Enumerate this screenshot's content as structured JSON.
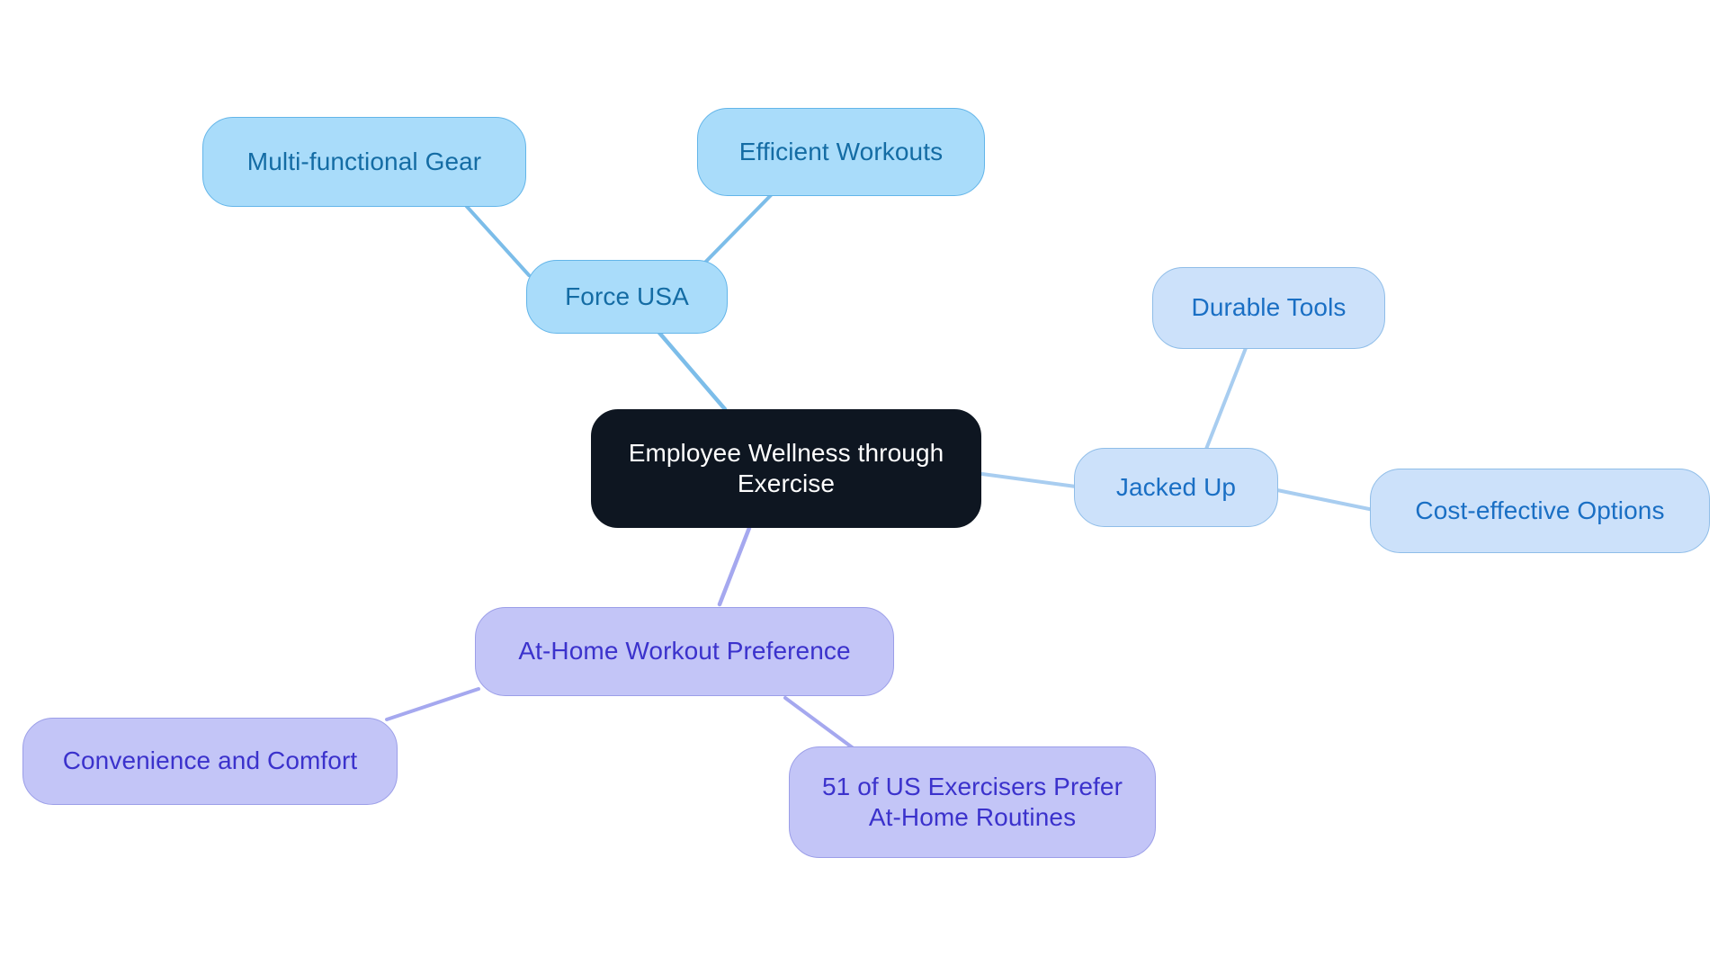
{
  "diagram": {
    "type": "mindmap",
    "title": "Employee Wellness through Exercise",
    "background_color": "#ffffff",
    "palette": {
      "root_fill": "#0e1621",
      "root_text": "#ffffff",
      "blue_fill": "#a9dcfa",
      "blue_border": "#63b5e9",
      "blue_text": "#146ca4",
      "lightblue_fill": "#cce1fa",
      "lightblue_border": "#8fbde8",
      "lightblue_text": "#1a6fc4",
      "purple_fill": "#c3c5f7",
      "purple_border": "#9b9ee8",
      "purple_text": "#3b32cc",
      "edge_blue": "#7cbde9",
      "edge_lightblue": "#a8cdf0",
      "edge_purple": "#a5a8ef"
    }
  },
  "nodes": {
    "root": {
      "label": "Employee Wellness through\nExercise"
    },
    "force_usa": {
      "label": "Force USA"
    },
    "multi_functional_gear": {
      "label": "Multi-functional Gear"
    },
    "efficient_workouts": {
      "label": "Efficient Workouts"
    },
    "jacked_up": {
      "label": "Jacked Up"
    },
    "durable_tools": {
      "label": "Durable Tools"
    },
    "cost_effective_options": {
      "label": "Cost-effective Options"
    },
    "at_home_workout_preference": {
      "label": "At-Home Workout Preference"
    },
    "convenience_and_comfort": {
      "label": "Convenience and Comfort"
    },
    "exercisers_stat": {
      "label": "51 of US Exercisers Prefer\nAt-Home Routines"
    }
  },
  "edges": [
    {
      "from": "root",
      "to": "force_usa",
      "color": "#7cbde9"
    },
    {
      "from": "force_usa",
      "to": "multi_functional_gear",
      "color": "#7cbde9"
    },
    {
      "from": "force_usa",
      "to": "efficient_workouts",
      "color": "#7cbde9"
    },
    {
      "from": "root",
      "to": "jacked_up",
      "color": "#a8cdf0"
    },
    {
      "from": "jacked_up",
      "to": "durable_tools",
      "color": "#a8cdf0"
    },
    {
      "from": "jacked_up",
      "to": "cost_effective_options",
      "color": "#a8cdf0"
    },
    {
      "from": "root",
      "to": "at_home_workout_preference",
      "color": "#a5a8ef"
    },
    {
      "from": "at_home_workout_preference",
      "to": "convenience_and_comfort",
      "color": "#a5a8ef"
    },
    {
      "from": "at_home_workout_preference",
      "to": "exercisers_stat",
      "color": "#a5a8ef"
    }
  ]
}
